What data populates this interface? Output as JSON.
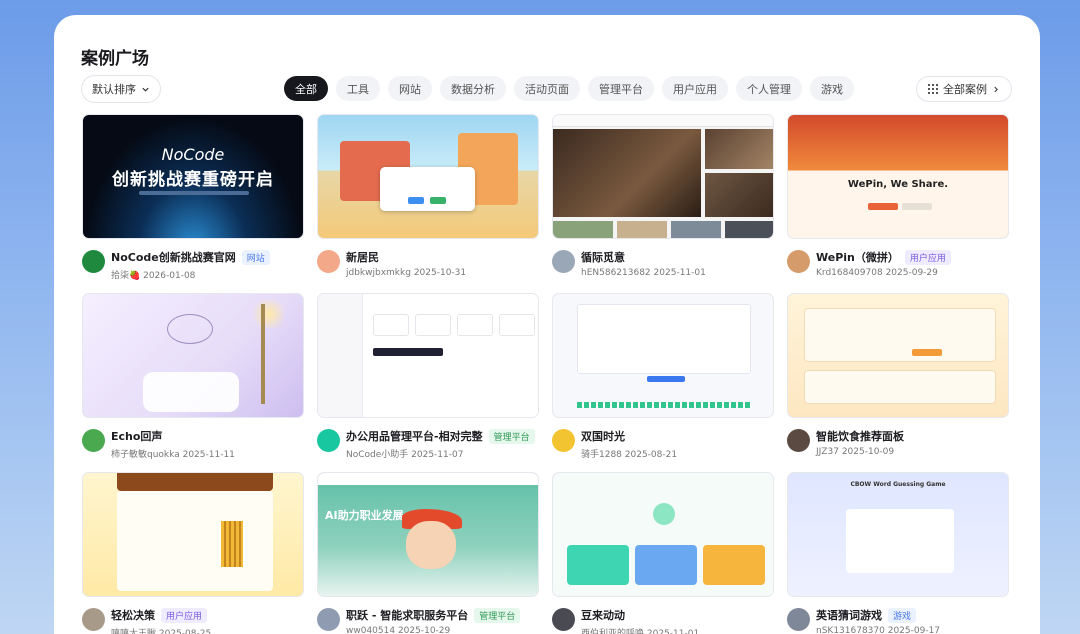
{
  "header": {
    "title": "案例广场",
    "sort_label": "默认排序",
    "all_cases_label": "全部案例"
  },
  "filters": [
    "全部",
    "工具",
    "网站",
    "数据分析",
    "活动页面",
    "管理平台",
    "用户应用",
    "个人管理",
    "游戏"
  ],
  "active_filter": "全部",
  "cards": [
    {
      "name": "NoCode创新挑战赛官网",
      "tag": "网站",
      "tag_color": "blue",
      "author": "拾柒🍓",
      "date": "2026-01-08",
      "avatar_color": "#1f8a3d",
      "thumb": "dark",
      "thumb_text1": "NoCode",
      "thumb_text2": "创新挑战赛重磅开启"
    },
    {
      "name": "新居民",
      "tag": "",
      "tag_color": "",
      "author": "jdbkwjbxmkkg",
      "date": "2025-10-31",
      "avatar_color": "#f2a889",
      "thumb": "town"
    },
    {
      "name": "循际觅意",
      "tag": "",
      "tag_color": "",
      "author": "hEN586213682",
      "date": "2025-11-01",
      "avatar_color": "#9aa7b6",
      "thumb": "cafe"
    },
    {
      "name": "WePin（微拼）",
      "tag": "用户应用",
      "tag_color": "purple",
      "author": "Krd168409708",
      "date": "2025-09-29",
      "avatar_color": "#d59b6a",
      "thumb": "wepin",
      "thumb_text1": "WePin, We Share."
    },
    {
      "name": "Echo回声",
      "tag": "",
      "tag_color": "",
      "author": "柿子敏敏quokka",
      "date": "2025-11-11",
      "avatar_color": "#4aa84f",
      "thumb": "echo"
    },
    {
      "name": "办公用品管理平台-相对完整",
      "tag": "管理平台",
      "tag_color": "green",
      "author": "NoCode小助手",
      "date": "2025-11-07",
      "avatar_color": "#18c6a0",
      "thumb": "office"
    },
    {
      "name": "双国时光",
      "tag": "",
      "tag_color": "",
      "author": "骑手1288",
      "date": "2025-08-21",
      "avatar_color": "#f3c431",
      "thumb": "time"
    },
    {
      "name": "智能饮食推荐面板",
      "tag": "",
      "tag_color": "",
      "author": "JJZ37",
      "date": "2025-10-09",
      "avatar_color": "#5a4a42",
      "thumb": "drink"
    },
    {
      "name": "轻松决策",
      "tag": "用户应用",
      "tag_color": "purple",
      "author": "嘻嘻大王瞅",
      "date": "2025-08-25",
      "avatar_color": "#a89a88",
      "thumb": "decide"
    },
    {
      "name": "职跃 - 智能求职服务平台",
      "tag": "管理平台",
      "tag_color": "green",
      "author": "ww040514",
      "date": "2025-10-29",
      "avatar_color": "#8f9bb0",
      "thumb": "career",
      "thumb_text1": "AI助力职业发展"
    },
    {
      "name": "豆来动动",
      "tag": "",
      "tag_color": "",
      "author": "西伯利亚的呼唤",
      "date": "2025-11-01",
      "avatar_color": "#4a4a52",
      "thumb": "pea"
    },
    {
      "name": "英语猜词游戏",
      "tag": "游戏",
      "tag_color": "blue",
      "author": "nSK131678370",
      "date": "2025-09-17",
      "avatar_color": "#7f8899",
      "thumb": "word",
      "thumb_text1": "CBOW Word Guessing Game"
    }
  ],
  "colors": {
    "active_chip_bg": "#16181d",
    "panel_bg": "#ffffff",
    "accent_blue": "#4a78e6"
  }
}
